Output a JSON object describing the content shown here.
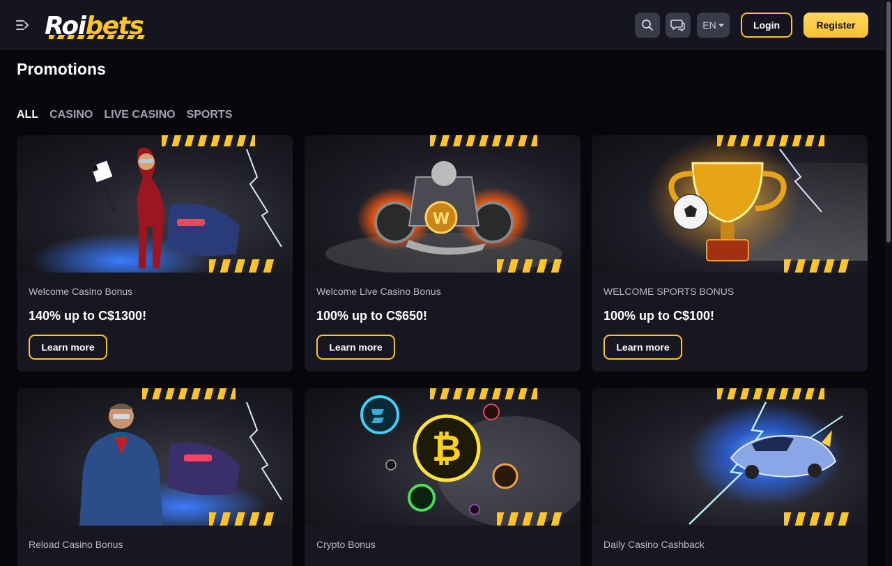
{
  "header": {
    "logo_part1": "Roi",
    "logo_part2": "bets",
    "language": "EN",
    "login_label": "Login",
    "register_label": "Register",
    "icons": [
      "menu-toggle-icon",
      "search-icon",
      "chat-icon",
      "chevron-down-icon"
    ]
  },
  "page": {
    "title": "Promotions"
  },
  "tabs": [
    {
      "label": "ALL",
      "active": true
    },
    {
      "label": "CASINO",
      "active": false
    },
    {
      "label": "LIVE CASINO",
      "active": false
    },
    {
      "label": "SPORTS",
      "active": false
    }
  ],
  "promotions": [
    {
      "subtitle": "Welcome Casino Bonus",
      "title": "140% up to C$1300!",
      "button": "Learn more",
      "image": "race-girl-car"
    },
    {
      "subtitle": "Welcome Live Casino Bonus",
      "title": "100% up to C$650!",
      "button": "Learn more",
      "image": "flaming-motorcycle-engine"
    },
    {
      "subtitle": "WELCOME SPORTS BONUS",
      "title": "100% up to C$100!",
      "button": "Learn more",
      "image": "golden-trophy-football"
    },
    {
      "subtitle": "Reload Casino Bonus",
      "title": "",
      "button": "",
      "image": "racer-man-car"
    },
    {
      "subtitle": "Crypto Bonus",
      "title": "",
      "button": "",
      "image": "crypto-coins"
    },
    {
      "subtitle": "Daily Casino Cashback",
      "title": "",
      "button": "",
      "image": "futuristic-car-lightning"
    }
  ],
  "colors": {
    "accent": "#ffc425",
    "background": "#07070b",
    "header": "#15151f",
    "card": "#171721"
  }
}
